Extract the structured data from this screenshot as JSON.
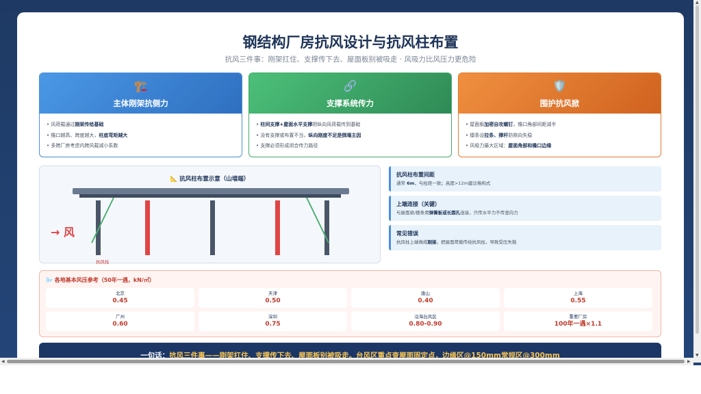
{
  "header": {
    "title": "钢结构厂房抗风设计与抗风柱布置",
    "subtitle": "抗风三件事：刚架扛住、支撑传下去、屋面板别被吸走 · 风吸力比风压力更危险"
  },
  "cards": [
    {
      "icon": "🏗️",
      "title": "主体刚架抗侧力",
      "lines": [
        {
          "pre": "风荷载通过",
          "bold": "刚架传给基础",
          "post": ""
        },
        {
          "pre": "檐口越高、跨度越大，",
          "bold": "柱底弯矩越大",
          "post": ""
        },
        {
          "pre": "多跨厂房考虑内跨风载减小系数",
          "bold": "",
          "post": ""
        }
      ]
    },
    {
      "icon": "🔗",
      "title": "支撑系统传力",
      "lines": [
        {
          "pre": "",
          "bold": "柱间支撑+屋面水平支撑",
          "post": "把纵向风荷载传到基础"
        },
        {
          "pre": "没有支撑或布置不当，",
          "bold": "纵向刚度不足是倒塌主因",
          "post": ""
        },
        {
          "pre": "支撑必须形成闭合传力路径",
          "bold": "",
          "post": ""
        }
      ]
    },
    {
      "icon": "🛡️",
      "title": "围护抗风掀",
      "lines": [
        {
          "pre": "屋面板",
          "bold": "加密自攻螺钉",
          "post": "，檐口角部间距减半"
        },
        {
          "pre": "檩条设",
          "bold": "拉条、撑杆",
          "post": "防侧向失稳"
        },
        {
          "pre": "风吸力最大区域：",
          "bold": "屋面角部和檐口边缘",
          "post": ""
        }
      ]
    }
  ],
  "diagram": {
    "title": "📐 抗风柱布置示意（山墙端）",
    "wind_label": "→ 风",
    "column_caption": "抗风柱"
  },
  "info_panels": [
    {
      "title": "抗风柱布置间距",
      "pre": "通常 ",
      "bold": "6m",
      "post": "，与柱距一致；高度>12m建议格构式"
    },
    {
      "title": "上端连接（关键）",
      "pre": "与屋面梁/檩条用",
      "bold": "弹簧板或长圆孔",
      "post": "连接，只传水平力不传竖向力"
    },
    {
      "title": "常见错误",
      "pre": "抗风柱上端做成",
      "bold": "刚接",
      "post": "，把屋面荷载传给抗风柱，导致受压失稳"
    }
  ],
  "pressure": {
    "title": "🌬️ 各地基本风压参考（50年一遇，kN/㎡）",
    "cells": [
      {
        "name": "北京",
        "value": "0.45"
      },
      {
        "name": "天津",
        "value": "0.50"
      },
      {
        "name": "唐山",
        "value": "0.40"
      },
      {
        "name": "上海",
        "value": "0.55"
      },
      {
        "name": "广州",
        "value": "0.60"
      },
      {
        "name": "深圳",
        "value": "0.75"
      },
      {
        "name": "沿海台风区",
        "value": "0.80-0.90"
      },
      {
        "name": "重要厂房",
        "value": "100年一遇×1.1"
      }
    ]
  },
  "banner": {
    "prefix": "一句话：",
    "text": "抗风三件事——刚架扛住、支撑传下去、屋面板别被吸走。台风区重点查屋面固定点，边缘区@150mm常规区@300mm"
  },
  "colors": {
    "primary_dark": "#1d3357",
    "blue": "#4a8fd8",
    "green": "#45a86a",
    "orange": "#e07b2e",
    "red": "#c0392b"
  }
}
